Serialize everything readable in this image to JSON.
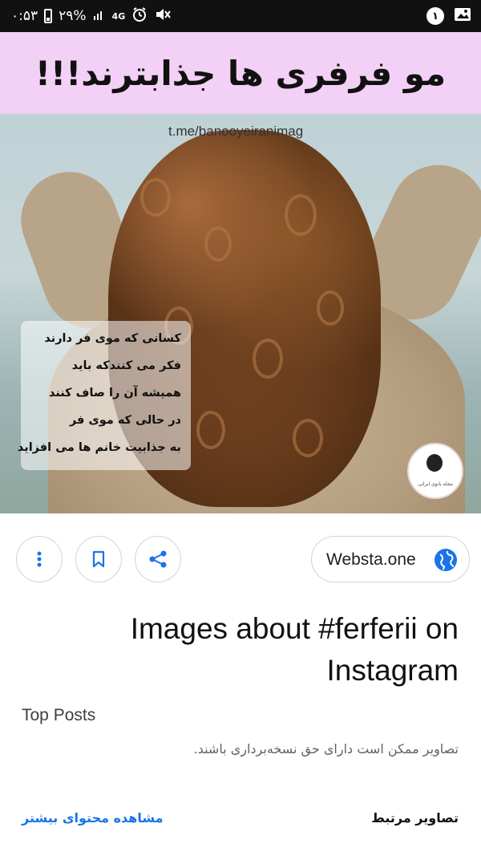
{
  "status_bar": {
    "time": "۰:۵۳",
    "battery": "۲۹%",
    "network": "4G",
    "notification_count": "۱"
  },
  "image": {
    "headline": "مو فرفری ها جذابترند!!!",
    "watermark": "t.me/banooyeiranimag",
    "overlay_lines": [
      "کسانی که موی فر دارند",
      "فکر می کنندکه باید",
      "همیشه آن را صاف کنند",
      "در حالی که موی فر",
      "به جذابیت خانم ها می افزاید"
    ],
    "logo_text": "مجله بانوی ایرانی"
  },
  "actions": {
    "more_icon": "more-vert-icon",
    "bookmark_icon": "bookmark-icon",
    "share_icon": "share-icon",
    "source_label": "Websta.one",
    "source_icon": "globe-icon"
  },
  "result": {
    "title": "Images about #ferferii on Instagram",
    "subtitle": "Top Posts",
    "copyright_notice": "تصاویر ممکن است دارای حق نسخه‌برداری باشند.",
    "related_label": "تصاویر مرتبط",
    "more_link": "مشاهده محتوای بیشتر"
  },
  "colors": {
    "accent": "#1a73e8",
    "headline_band": "#f3d0f5"
  }
}
